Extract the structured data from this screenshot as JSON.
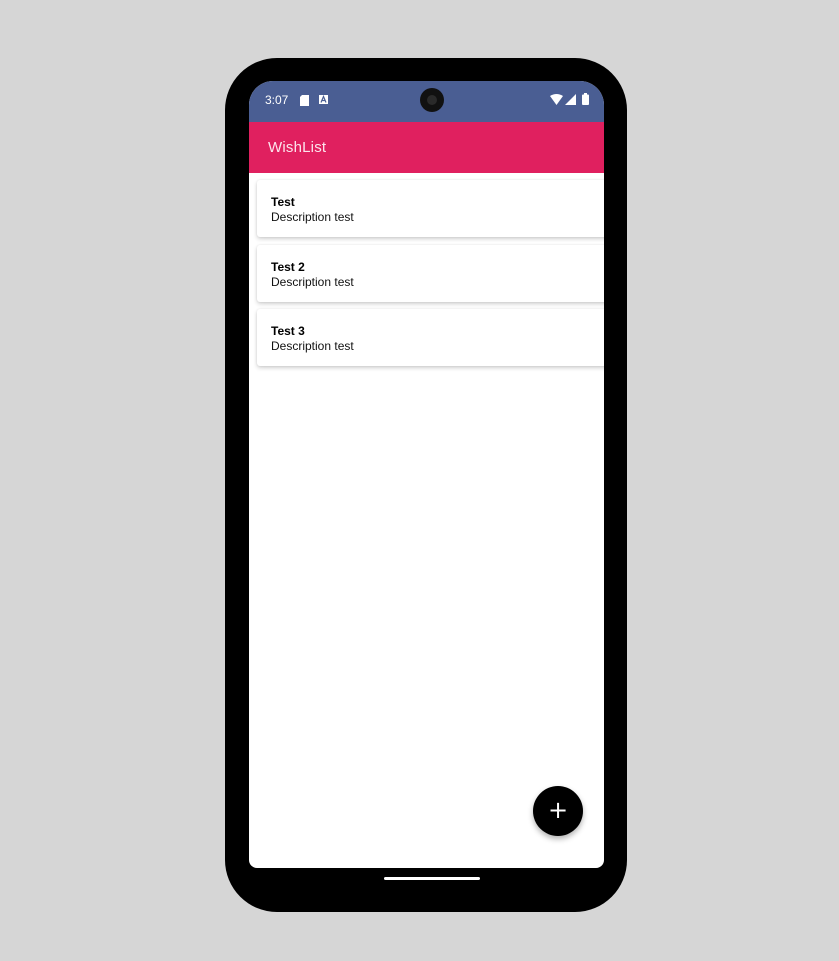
{
  "status_bar": {
    "time": "3:07",
    "icons": [
      "sd-card-icon",
      "a-notification-icon",
      "camera-icon",
      "wifi-icon",
      "signal-icon",
      "battery-icon"
    ]
  },
  "app_bar": {
    "title": "WishList",
    "color": "#e0205f"
  },
  "status_color": "#4a5e93",
  "items": [
    {
      "title": "Test",
      "description": "Description test"
    },
    {
      "title": "Test 2",
      "description": "Description test"
    },
    {
      "title": "Test 3",
      "description": "Description test"
    }
  ],
  "fab": {
    "icon": "plus-icon",
    "label": "+"
  }
}
